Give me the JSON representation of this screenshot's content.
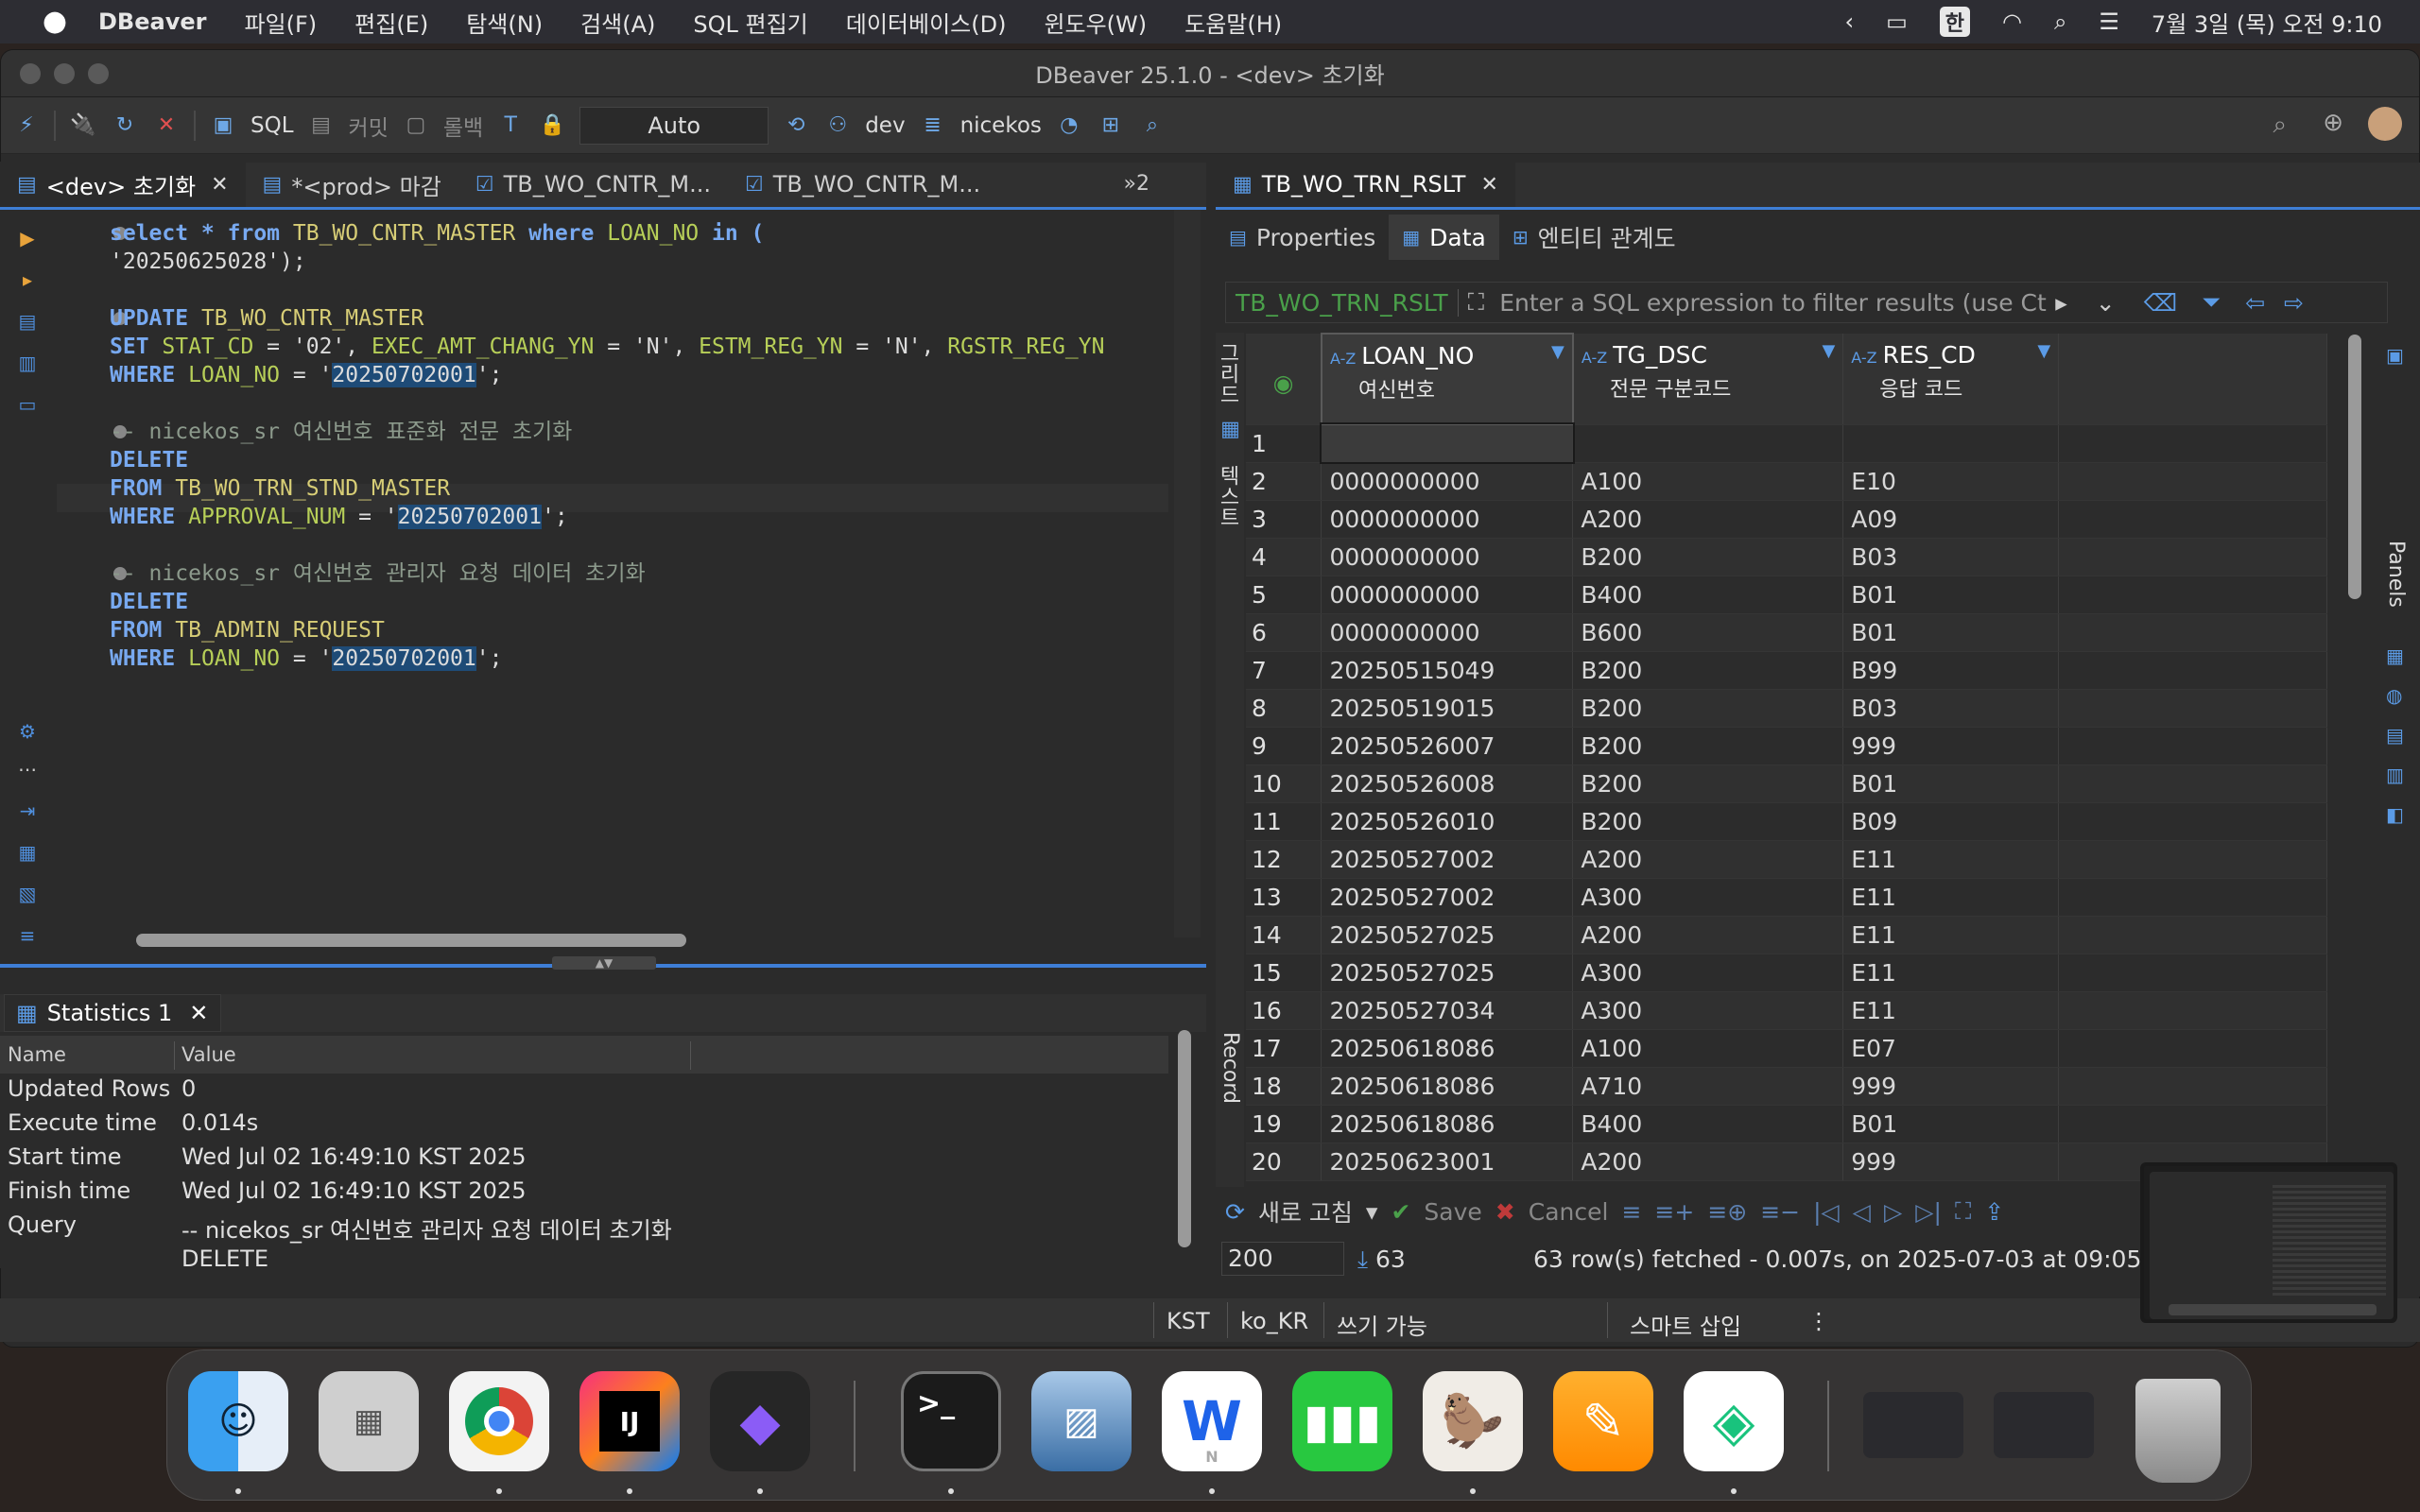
{
  "menubar": {
    "app_name": "DBeaver",
    "items": [
      "파일(F)",
      "편집(E)",
      "탐색(N)",
      "검색(A)",
      "SQL 편집기",
      "데이터베이스(D)",
      "윈도우(W)",
      "도움말(H)"
    ],
    "input_source": "한",
    "clock": "7월 3일 (목) 오전 9:10"
  },
  "window": {
    "title": "DBeaver 25.1.0 - <dev> 초기화"
  },
  "toolbar": {
    "sql_label": "SQL",
    "commit_label": "커밋",
    "rollback_label": "롤백",
    "transaction_mode": "Auto",
    "connection": "dev",
    "schema": "nicekos"
  },
  "editor": {
    "tabs": [
      {
        "label": "<dev> 초기화",
        "active": true
      },
      {
        "label": "*<prod> 마감",
        "active": false
      },
      {
        "label": "TB_WO_CNTR_M...",
        "active": false
      },
      {
        "label": "TB_WO_CNTR_M...",
        "active": false
      }
    ],
    "more_tabs": "»2",
    "code": {
      "l1_a": "select * from ",
      "l1_table": "TB_WO_CNTR_MASTER",
      "l1_b": " where ",
      "l1_col": "LOAN_NO",
      "l1_c": " in (",
      "l2": "'20250625028');",
      "l4_a": "UPDATE ",
      "l4_table": "TB_WO_CNTR_MASTER",
      "l5_a": "SET ",
      "l5_c1": "STAT_CD",
      "l5_b": " = '02', ",
      "l5_c2": "EXEC_AMT_CHANG_YN",
      "l5_c": " = 'N', ",
      "l5_c3": "ESTM_REG_YN",
      "l5_d": " = 'N', ",
      "l5_c4": "RGSTR_REG_YN",
      "l6_a": "WHERE ",
      "l6_col": "LOAN_NO",
      "l6_b": " = '",
      "l6_val": "20250702001",
      "l6_c": "';",
      "l8": "-- nicekos_sr 여신번호 표준화 전문 초기화",
      "l9": "DELETE",
      "l10_a": "FROM ",
      "l10_table": "TB_WO_TRN_STND_MASTER",
      "l11_a": "WHERE ",
      "l11_col": "APPROVAL_NUM",
      "l11_b": " = '",
      "l11_val": "20250702001",
      "l11_c": "';",
      "l13": "-- nicekos_sr 여신번호 관리자 요청 데이터 초기화",
      "l14": "DELETE",
      "l15_a": "FROM ",
      "l15_table": "TB_ADMIN_REQUEST",
      "l16_a": "WHERE ",
      "l16_col": "LOAN_NO",
      "l16_b": " = '",
      "l16_val": "20250702001",
      "l16_c": "';"
    }
  },
  "statistics": {
    "tab_label": "Statistics 1",
    "col_name": "Name",
    "col_value": "Value",
    "rows": [
      {
        "name": "Updated Rows",
        "value": "0"
      },
      {
        "name": "Execute time",
        "value": "0.014s"
      },
      {
        "name": "Start time",
        "value": "Wed Jul 02 16:49:10 KST 2025"
      },
      {
        "name": "Finish time",
        "value": "Wed Jul 02 16:49:10 KST 2025"
      },
      {
        "name": "Query",
        "value": "-- nicekos_sr 여신번호 관리자 요청 데이터 초기화"
      },
      {
        "name": "",
        "value": "DELETE"
      }
    ]
  },
  "results": {
    "tab_label": "TB_WO_TRN_RSLT",
    "subtabs": [
      "Properties",
      "Data",
      "엔티티 관계도"
    ],
    "filter_table": "TB_WO_TRN_RSLT",
    "filter_placeholder": "Enter a SQL expression to filter results (use Ct",
    "vertical_tabs": [
      "그리드",
      "텍스트",
      "Record"
    ],
    "side_label": "Panels",
    "columns": [
      {
        "name": "LOAN_NO",
        "desc": "여신번호"
      },
      {
        "name": "TG_DSC",
        "desc": "전문 구분코드"
      },
      {
        "name": "RES_CD",
        "desc": "응답 코드"
      }
    ],
    "rows": [
      [
        "1",
        "",
        "",
        ""
      ],
      [
        "2",
        "0000000000",
        "A100",
        "E10"
      ],
      [
        "3",
        "0000000000",
        "A200",
        "A09"
      ],
      [
        "4",
        "0000000000",
        "B200",
        "B03"
      ],
      [
        "5",
        "0000000000",
        "B400",
        "B01"
      ],
      [
        "6",
        "0000000000",
        "B600",
        "B01"
      ],
      [
        "7",
        "20250515049",
        "B200",
        "B99"
      ],
      [
        "8",
        "20250519015",
        "B200",
        "B03"
      ],
      [
        "9",
        "20250526007",
        "B200",
        "999"
      ],
      [
        "10",
        "20250526008",
        "B200",
        "B01"
      ],
      [
        "11",
        "20250526010",
        "B200",
        "B09"
      ],
      [
        "12",
        "20250527002",
        "A200",
        "E11"
      ],
      [
        "13",
        "20250527002",
        "A300",
        "E11"
      ],
      [
        "14",
        "20250527025",
        "A200",
        "E11"
      ],
      [
        "15",
        "20250527025",
        "A300",
        "E11"
      ],
      [
        "16",
        "20250527034",
        "A300",
        "E11"
      ],
      [
        "17",
        "20250618086",
        "A100",
        "E07"
      ],
      [
        "18",
        "20250618086",
        "A710",
        "999"
      ],
      [
        "19",
        "20250618086",
        "B400",
        "B01"
      ],
      [
        "20",
        "20250623001",
        "A200",
        "999"
      ]
    ],
    "refresh_label": "새로 고침",
    "save_label": "Save",
    "cancel_label": "Cancel",
    "fetch_size": "200",
    "row_count": "63",
    "fetched_text": "63 row(s) fetched - 0.007s, on 2025-07-03 at 09:05"
  },
  "statusbar": {
    "timezone": "KST",
    "locale": "ko_KR",
    "mode": "쓰기 가능",
    "insert_mode": "스마트 삽입"
  },
  "dock": {
    "apps": [
      "finder",
      "launchpad",
      "chrome",
      "intellij",
      "obsidian",
      "terminal",
      "preview",
      "naver-whale",
      "numbers",
      "dbeaver",
      "pages",
      "naver-myBox"
    ]
  }
}
